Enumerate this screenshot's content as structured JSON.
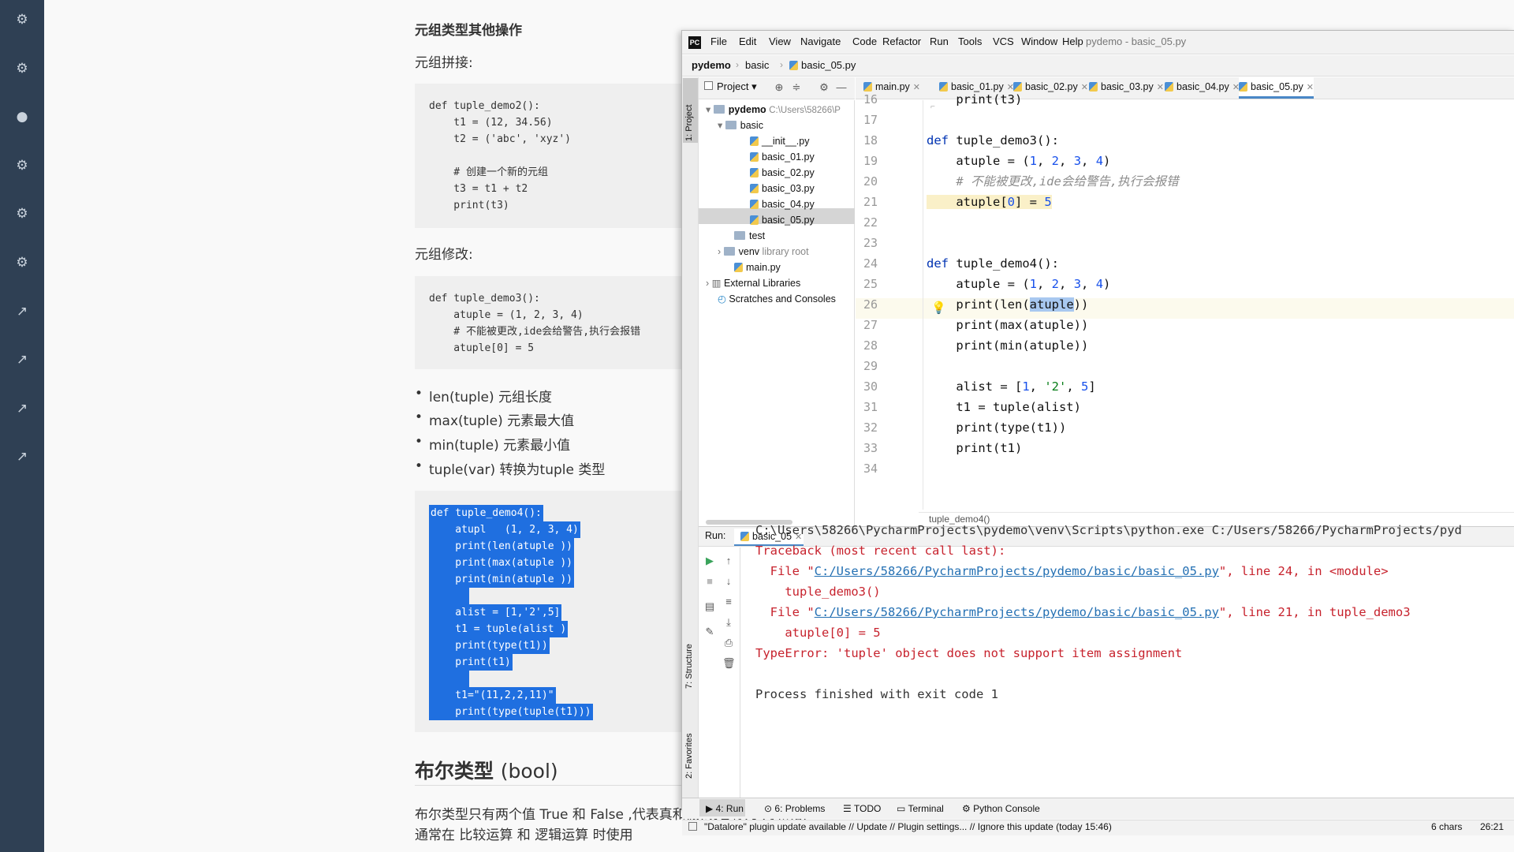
{
  "article": {
    "h_other_ops": "元组类型其他操作",
    "p_concat": "元组拼接:",
    "code1": [
      "def tuple_demo2():",
      "    t1 = (12, 34.56)",
      "    t2 = ('abc', 'xyz')",
      "",
      "    # 创建一个新的元组",
      "    t3 = t1 + t2",
      "    print(t3)"
    ],
    "p_modify": "元组修改:",
    "code2": [
      "def tuple_demo3():",
      "    atuple = (1, 2, 3, 4)",
      "    # 不能被更改,ide会给警告,执行会报错",
      "    atuple[0] = 5"
    ],
    "bullets": [
      "len(tuple) 元组长度",
      "max(tuple) 元素最大值",
      "min(tuple) 元素最小值",
      "tuple(var) 转换为tuple 类型"
    ],
    "selected_code": [
      "def tuple_demo4():",
      "    atupl   (1, 2, 3, 4)",
      "    print(len(atuple ))",
      "    print(max(atuple ))",
      "    print(min(atuple ))",
      "",
      "    alist = [1,'2',5]",
      "    t1 = tuple(alist )",
      "    print(type(t1))",
      "    print(t1)",
      "",
      "    t1=\"(11,2,2,11)\"",
      "    print(type(tuple(t1)))"
    ],
    "h_bool_cn": "布尔类型",
    "h_bool_en": "(bool)",
    "p_bool1": "布尔类型只有两个值 True 和 False ,代表真和假(或者称为 对和错).",
    "p_bool2": "通常在 比较运算 和 逻辑运算 时使用"
  },
  "ide": {
    "menu": [
      "File",
      "Edit",
      "View",
      "Navigate",
      "Code",
      "Refactor",
      "Run",
      "Tools",
      "VCS",
      "Window",
      "Help"
    ],
    "title": "pydemo - basic_05.py",
    "breadcrumb": [
      "pydemo",
      "basic",
      "basic_05.py"
    ],
    "project_label": "Project",
    "side_project": "1: Project",
    "side_structure": "7: Structure",
    "side_favorites": "2: Favorites",
    "tabs": [
      "main.py",
      "basic_01.py",
      "basic_02.py",
      "basic_03.py",
      "basic_04.py",
      "basic_05.py"
    ],
    "tree": {
      "root": "pydemo",
      "root_path": "C:\\Users\\58266\\P",
      "basic": "basic",
      "files": [
        "__init__.py",
        "basic_01.py",
        "basic_02.py",
        "basic_03.py",
        "basic_04.py",
        "basic_05.py"
      ],
      "test": "test",
      "venv": "venv",
      "venv_note": "library root",
      "main": "main.py",
      "ext": "External Libraries",
      "scratches": "Scratches and Consoles"
    },
    "line_numbers": [
      "16",
      "17",
      "18",
      "19",
      "20",
      "21",
      "22",
      "23",
      "24",
      "25",
      "26",
      "27",
      "28",
      "29",
      "30",
      "31",
      "32",
      "33",
      "34"
    ],
    "code": {
      "l16": "    print(t3)",
      "l18_kw": "def",
      "l18": " tuple_demo3():",
      "l19": "    atuple = (",
      "l20": "    # 不能被更改,ide会给警告,执行会报错",
      "l21": "    atuple[",
      "l24_kw": "def",
      "l24": " tuple_demo4():",
      "l25": "    atuple = (",
      "l26a": "    print(len(",
      "l26b": "atuple",
      "l26c": "))",
      "l27": "    print(max(atuple))",
      "l28": "    print(min(atuple))",
      "l30": "    alist = [",
      "l31": "    t1 = tuple(alist)",
      "l32": "    print(type(t1))",
      "l33": "    print(t1)"
    },
    "breadcrumb_func": "tuple_demo4()",
    "run_label": "Run:",
    "run_tab": "basic_05",
    "console": {
      "cmd": "C:\\Users\\58266\\PycharmProjects\\pydemo\\venv\\Scripts\\python.exe C:/Users/58266/PycharmProjects/pyd",
      "tb": "Traceback (most recent call last):",
      "f1_pre": "  File \"",
      "f1_link": "C:/Users/58266/PycharmProjects/pydemo/basic/basic_05.py",
      "f1_post": "\", line 24, in <module>",
      "f1_code": "    tuple_demo3()",
      "f2_pre": "  File \"",
      "f2_link": "C:/Users/58266/PycharmProjects/pydemo/basic/basic_05.py",
      "f2_post": "\", line 21, in tuple_demo3",
      "f2_code": "    atuple[0] = 5",
      "err": "TypeError: 'tuple' object does not support item assignment",
      "exit": "Process finished with exit code 1"
    },
    "bottom_tabs": [
      "4: Run",
      "6: Problems",
      "TODO",
      "Terminal",
      "Python Console"
    ],
    "status": "\"Datalore\" plugin update available // Update // Plugin settings... // Ignore this update (today 15:46)",
    "status_chars": "6 chars",
    "status_pos": "26:21"
  }
}
